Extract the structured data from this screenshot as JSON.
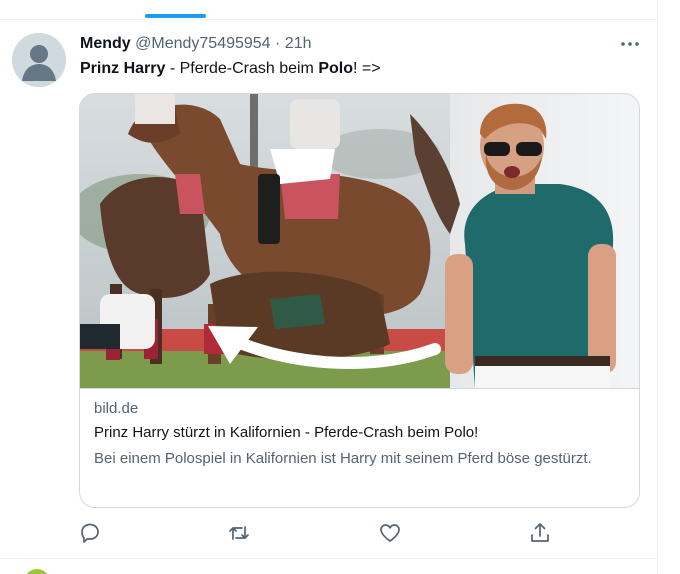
{
  "tweet": {
    "display_name": "Mendy",
    "handle_time": "@Mendy75495954 · 21h",
    "text_parts": [
      "Prinz Harry",
      " - Pferde-Crash beim ",
      "Polo",
      "! =>"
    ]
  },
  "card": {
    "domain": "bild.de",
    "title": "Prinz Harry stürzt in Kalifornien - Pferde-Crash beim Polo!",
    "description": "Bei einem Polospiel in Kalifornien ist Harry mit seinem Pferd böse gestürzt."
  },
  "icons": {
    "more": "more-icon",
    "reply": "reply-icon",
    "retweet": "retweet-icon",
    "like": "heart-icon",
    "share": "share-icon"
  },
  "colors": {
    "accent": "#1d9bf0",
    "secondary_text": "#536471",
    "border": "#cfd9de"
  }
}
